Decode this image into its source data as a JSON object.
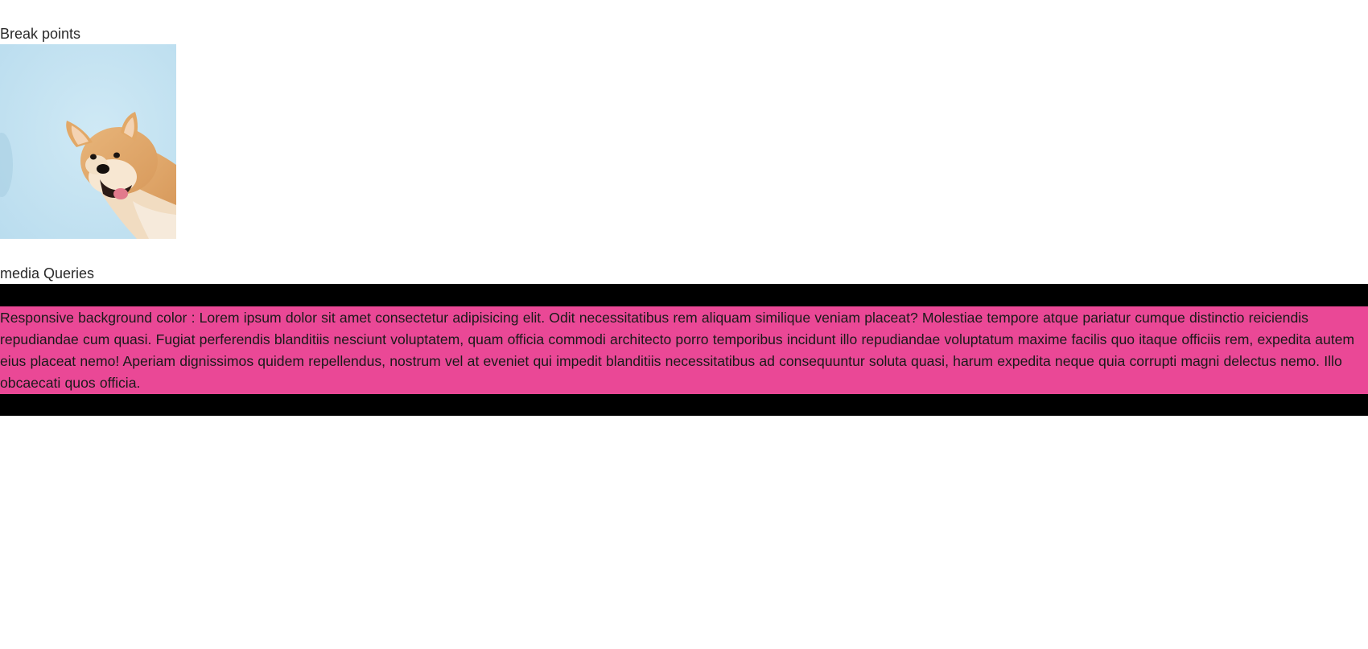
{
  "sections": {
    "breakpoints_heading": "Break points",
    "media_queries_heading": "media Queries"
  },
  "image": {
    "subject": "dog-photo",
    "background_color": "#c3e3f2"
  },
  "responsive_block": {
    "text": "Responsive background color : Lorem ipsum dolor sit amet consectetur adipisicing elit. Odit necessitatibus rem aliquam similique veniam placeat? Molestiae tempore atque pariatur cumque distinctio reiciendis repudiandae cum quasi. Fugiat perferendis blanditiis nesciunt voluptatem, quam officia commodi architecto porro temporibus incidunt illo repudiandae voluptatum maxime facilis quo itaque officiis rem, expedita autem eius placeat nemo! Aperiam dignissimos quidem repellendus, nostrum vel at eveniet qui impedit blanditiis necessitatibus ad consequuntur soluta quasi, harum expedita neque quia corrupti magni delectus nemo. Illo obcaecati quos officia.",
    "background_color": "#ea4896",
    "border_color": "#000000"
  }
}
